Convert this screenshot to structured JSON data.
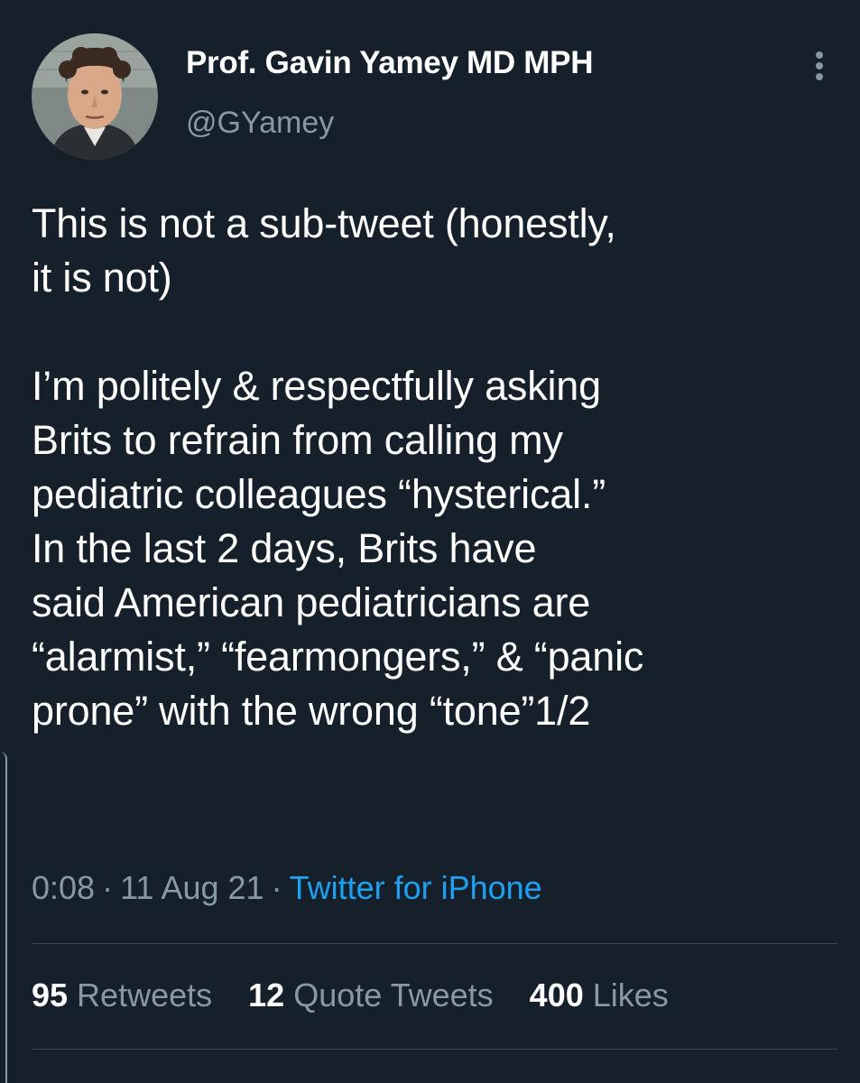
{
  "author": {
    "display_name": "Prof. Gavin Yamey MD MPH",
    "handle": "@GYamey",
    "avatar_icon": "profile-photo"
  },
  "menu_icon": "more-vertical-icon",
  "tweet": {
    "text": "This is not a sub-tweet (honestly,\nit is not)\n\nI’m politely & respectfully asking\nBrits to refrain from calling my\npediatric colleagues “hysterical.”\nIn the last 2 days, Brits have\nsaid American pediatricians are\n“alarmist,” “fearmongers,” & “panic\nprone” with the wrong “tone”1/2",
    "time": "0:08",
    "date": "11 Aug 21",
    "separator": "·",
    "source": "Twitter for iPhone"
  },
  "stats": {
    "retweets": {
      "count": "95",
      "label": "Retweets"
    },
    "quote_tweets": {
      "count": "12",
      "label": "Quote Tweets"
    },
    "likes": {
      "count": "400",
      "label": "Likes"
    }
  },
  "colors": {
    "background": "#15202b",
    "primary_text": "#ffffff",
    "secondary_text": "#8899a6",
    "link": "#1da1f2",
    "divider": "#38444d"
  }
}
